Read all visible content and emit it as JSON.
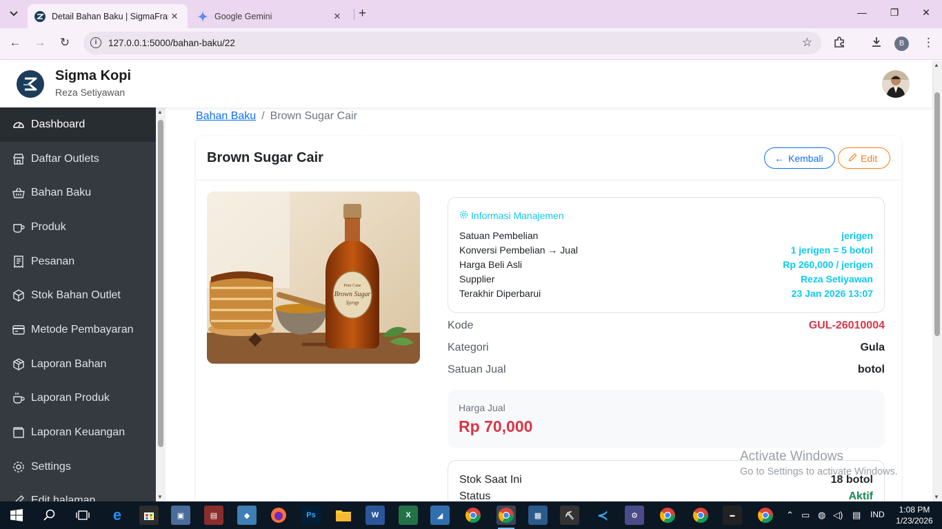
{
  "browser": {
    "tabs": [
      {
        "title": "Detail Bahan Baku | SigmaFranc",
        "active": true
      },
      {
        "title": "Google Gemini",
        "active": false
      }
    ],
    "url": "127.0.0.1:5000/bahan-baku/22",
    "profile_initial": "B"
  },
  "header": {
    "brand_name": "Sigma Kopi",
    "user_name": "Reza Setiyawan"
  },
  "sidebar": {
    "items": [
      {
        "label": "Dashboard",
        "icon": "gauge-icon",
        "active": true
      },
      {
        "label": "Daftar Outlets",
        "icon": "shop-icon",
        "active": false
      },
      {
        "label": "Bahan Baku",
        "icon": "basket-icon",
        "active": false
      },
      {
        "label": "Produk",
        "icon": "cup-icon",
        "active": false
      },
      {
        "label": "Pesanan",
        "icon": "receipt-icon",
        "active": false
      },
      {
        "label": "Stok Bahan Outlet",
        "icon": "box-icon",
        "active": false
      },
      {
        "label": "Metode Pembayaran",
        "icon": "credit-card-icon",
        "active": false
      },
      {
        "label": "Laporan Bahan",
        "icon": "box-seam-icon",
        "active": false
      },
      {
        "label": "Laporan Produk",
        "icon": "cup-hot-icon",
        "active": false
      },
      {
        "label": "Laporan Keuangan",
        "icon": "wallet-icon",
        "active": false
      },
      {
        "label": "Settings",
        "icon": "gear-icon",
        "active": false
      },
      {
        "label": "Edit halaman",
        "icon": "pencil-icon",
        "active": false
      }
    ]
  },
  "breadcrumb": {
    "parent": "Bahan Baku",
    "separator": "/",
    "current": "Brown Sugar Cair"
  },
  "detail": {
    "title": "Brown Sugar Cair",
    "back_label": "Kembali",
    "edit_label": "Edit",
    "image_label": {
      "line1": "Pure Cane",
      "line2": "Brown Sugar",
      "line3": "Syrup"
    },
    "management": {
      "title": "Informasi Manajemen",
      "rows": [
        {
          "label": "Satuan Pembelian",
          "value": "jerigen"
        },
        {
          "label": "Konversi Pembelian → Jual",
          "value": "1 jerigen = 5 botol"
        },
        {
          "label": "Harga Beli Asli",
          "value": "Rp 260,000 / jerigen"
        },
        {
          "label": "Supplier",
          "value": "Reza Setiyawan"
        },
        {
          "label": "Terakhir Diperbarui",
          "value": "23 Jan 2026 13:07"
        }
      ]
    },
    "attributes": [
      {
        "label": "Kode",
        "value": "GUL-26010004"
      },
      {
        "label": "Kategori",
        "value": "Gula"
      },
      {
        "label": "Satuan Jual",
        "value": "botol"
      }
    ],
    "price": {
      "label": "Harga Jual",
      "value": "Rp 70,000"
    },
    "stock": [
      {
        "label": "Stok Saat Ini",
        "value": "18 botol"
      },
      {
        "label": "Status",
        "value": "Aktif"
      }
    ]
  },
  "watermark": {
    "line1": "Activate Windows",
    "line2": "Go to Settings to activate Windows."
  },
  "taskbar": {
    "tray_language": "IND",
    "time": "1:08 PM",
    "date": "1/23/2026"
  },
  "colors": {
    "sidebar_bg": "#343a40",
    "primary": "#0d6efd",
    "warning": "#fd7e14",
    "info": "#0dcaf0",
    "danger": "#dc3545",
    "success": "#198754"
  }
}
